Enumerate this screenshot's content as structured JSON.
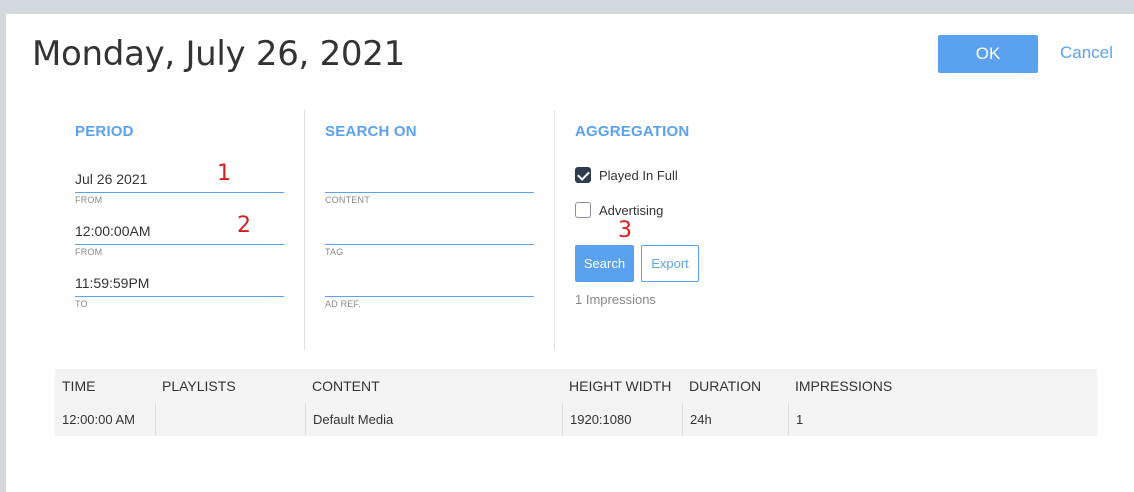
{
  "dialog": {
    "title": "Monday, July 26, 2021",
    "ok_label": "OK",
    "cancel_label": "Cancel"
  },
  "period": {
    "title": "PERIOD",
    "date_value": "Jul 26 2021",
    "date_label": "FROM",
    "from_time_value": "12:00:00AM",
    "from_time_label": "FROM",
    "to_time_value": "11:59:59PM",
    "to_time_label": "TO"
  },
  "search_on": {
    "title": "SEARCH ON",
    "content_value": "",
    "content_label": "CONTENT",
    "tag_value": "",
    "tag_label": "TAG",
    "ad_ref_value": "",
    "ad_ref_label": "AD REF."
  },
  "aggregation": {
    "title": "AGGREGATION",
    "played_in_full_label": "Played In Full",
    "played_in_full_checked": true,
    "advertising_label": "Advertising",
    "advertising_checked": false,
    "search_label": "Search",
    "export_label": "Export",
    "impressions_text": "1 Impressions"
  },
  "annotations": {
    "a1": "1",
    "a2": "2",
    "a3": "3",
    "color": "#d22020"
  },
  "table": {
    "headers": {
      "time": "TIME",
      "playlists": "PLAYLISTS",
      "content": "CONTENT",
      "height_width": "HEIGHT WIDTH",
      "duration": "DURATION",
      "impressions": "IMPRESSIONS"
    },
    "rows": [
      {
        "time": "12:00:00 AM",
        "playlists": "",
        "content": "Default Media",
        "height_width": "1920:1080",
        "duration": "24h",
        "impressions": "1"
      }
    ]
  },
  "colors": {
    "accent": "#5aa2ef",
    "backdrop": "#d3d8de",
    "checkbox_checked": "#2f3b4d"
  }
}
